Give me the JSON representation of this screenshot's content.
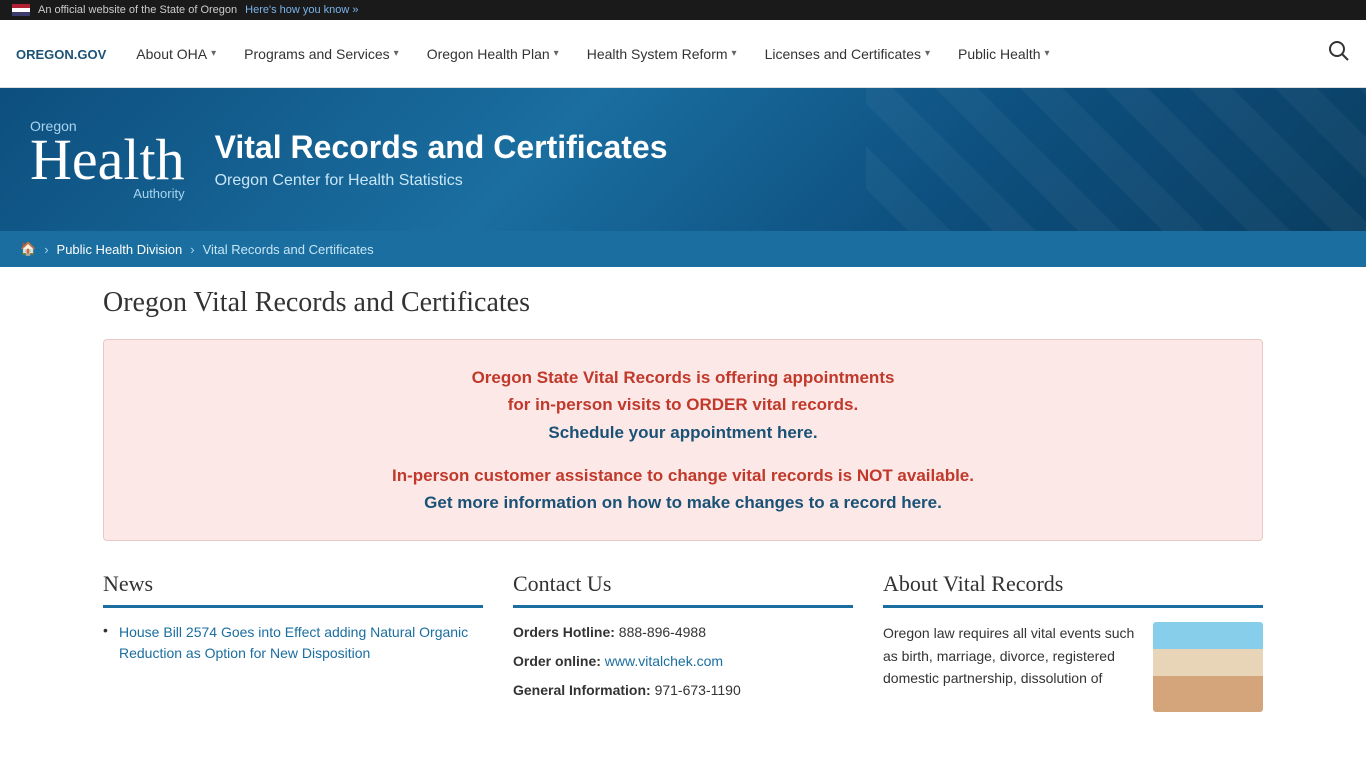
{
  "topbar": {
    "official_text": "An official website of the State of Oregon",
    "verify_link": "Here's how you know »"
  },
  "nav": {
    "logo_text": "OREGON.GOV",
    "items": [
      {
        "label": "About OHA",
        "id": "about-oha"
      },
      {
        "label": "Programs and Services",
        "id": "programs-services"
      },
      {
        "label": "Oregon Health Plan",
        "id": "oregon-health-plan"
      },
      {
        "label": "Health System Reform",
        "id": "health-system-reform"
      },
      {
        "label": "Licenses and Certificates",
        "id": "licenses-certificates"
      },
      {
        "label": "Public Health",
        "id": "public-health"
      }
    ]
  },
  "hero": {
    "logo_oregon": "Oregon",
    "logo_health": "Health",
    "logo_authority": "Authority",
    "title": "Vital Records and Certificates",
    "subtitle": "Oregon Center for Health Statistics"
  },
  "breadcrumb": {
    "home_label": "🏠",
    "item1": "Public Health Division",
    "item2": "Vital Records and Certificates"
  },
  "main": {
    "page_title": "Oregon Vital Records and Certificates",
    "notice": {
      "line1": "Oregon State Vital Records is offering appointments",
      "line2": "for in-person visits to ORDER vital records.",
      "link_text": "Schedule your appointment here",
      "line3_prefix": "In-person customer assistance to change vital records is ",
      "line3_bold": "NOT available.",
      "link2_text": "Get more information on how to make changes to a record here."
    },
    "news": {
      "heading": "News",
      "items": [
        {
          "text": "House Bill 2574 Goes into Effect adding Natural Organic Reduction as Option for New Disposition"
        }
      ]
    },
    "contact": {
      "heading": "Contact Us",
      "rows": [
        {
          "label": "Orders Hotline:",
          "value": "888-896-4988"
        },
        {
          "label": "Order online:",
          "value": "www.vitalchek.com",
          "is_link": true
        },
        {
          "label": "General Information:",
          "value": "971-673-1190"
        }
      ]
    },
    "about": {
      "heading": "About Vital Records",
      "text": "Oregon law requires all vital events such as birth, marriage, divorce, registered domestic partnership, dissolution of"
    }
  }
}
